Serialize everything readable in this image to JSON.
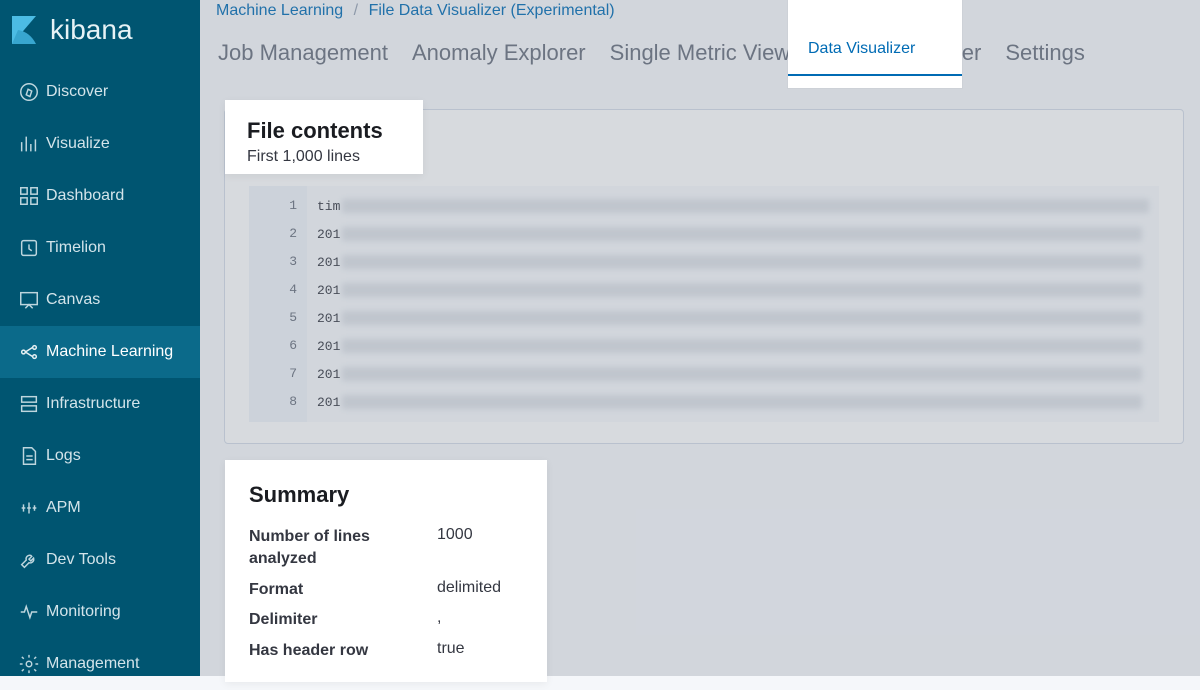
{
  "brand": {
    "name": "kibana"
  },
  "sidebar": {
    "items": [
      {
        "id": "discover",
        "label": "Discover"
      },
      {
        "id": "visualize",
        "label": "Visualize"
      },
      {
        "id": "dashboard",
        "label": "Dashboard"
      },
      {
        "id": "timelion",
        "label": "Timelion"
      },
      {
        "id": "canvas",
        "label": "Canvas"
      },
      {
        "id": "machine-learning",
        "label": "Machine Learning",
        "active": true
      },
      {
        "id": "infrastructure",
        "label": "Infrastructure"
      },
      {
        "id": "logs",
        "label": "Logs"
      },
      {
        "id": "apm",
        "label": "APM"
      },
      {
        "id": "dev-tools",
        "label": "Dev Tools"
      },
      {
        "id": "monitoring",
        "label": "Monitoring"
      },
      {
        "id": "management",
        "label": "Management"
      }
    ]
  },
  "breadcrumb": {
    "root": "Machine Learning",
    "current": "File Data Visualizer (Experimental)",
    "sep": "/"
  },
  "tabs": [
    {
      "id": "job-management",
      "label": "Job Management"
    },
    {
      "id": "anomaly-explorer",
      "label": "Anomaly Explorer"
    },
    {
      "id": "single-metric-viewer",
      "label": "Single Metric Viewer"
    },
    {
      "id": "data-visualizer",
      "label": "Data Visualizer",
      "active": true
    },
    {
      "id": "settings",
      "label": "Settings"
    }
  ],
  "file_contents": {
    "title": "File contents",
    "subtitle": "First 1,000 lines",
    "lines": [
      {
        "n": "1",
        "prefix": "tim"
      },
      {
        "n": "2",
        "prefix": "201"
      },
      {
        "n": "3",
        "prefix": "201"
      },
      {
        "n": "4",
        "prefix": "201"
      },
      {
        "n": "5",
        "prefix": "201"
      },
      {
        "n": "6",
        "prefix": "201"
      },
      {
        "n": "7",
        "prefix": "201"
      },
      {
        "n": "8",
        "prefix": "201"
      }
    ]
  },
  "summary": {
    "title": "Summary",
    "rows": [
      {
        "key": "Number of lines analyzed",
        "value": "1000"
      },
      {
        "key": "Format",
        "value": "delimited"
      },
      {
        "key": "Delimiter",
        "value": ","
      },
      {
        "key": "Has header row",
        "value": "true"
      }
    ]
  }
}
